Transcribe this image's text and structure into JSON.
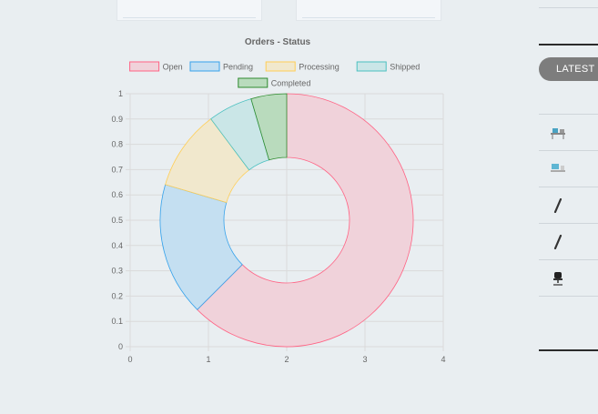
{
  "chart_data": {
    "type": "doughnut",
    "title": "Orders - Status",
    "legend_position": "top",
    "series": [
      {
        "name": "Open",
        "value": 0.6471,
        "color": "#ff6384",
        "fill": "#f0d2da"
      },
      {
        "name": "Pending",
        "value": 0.1765,
        "color": "#36a2eb",
        "fill": "#c4dff1"
      },
      {
        "name": "Processing",
        "value": 0.1059,
        "color": "#ffce56",
        "fill": "#f1e8cd"
      },
      {
        "name": "Shipped",
        "value": 0.0588,
        "color": "#4bc0c0",
        "fill": "#cae6e7"
      },
      {
        "name": "Completed",
        "value": 0.0471,
        "color": "#2e8b2e",
        "fill": "#b9dbbd"
      }
    ],
    "x_axis": {
      "min": 0,
      "max": 4,
      "ticks": [
        "0",
        "1",
        "2",
        "3",
        "4"
      ]
    },
    "y_axis": {
      "min": 0,
      "max": 1,
      "ticks": [
        "0",
        "0.1",
        "0.2",
        "0.3",
        "0.4",
        "0.5",
        "0.6",
        "0.7",
        "0.8",
        "0.9",
        "1"
      ]
    },
    "grid": true
  },
  "right_panel": {
    "tab_label": "LATEST P",
    "items": [
      {
        "icon": "desk-set-icon"
      },
      {
        "icon": "workstation-icon"
      },
      {
        "icon": "pen-icon"
      },
      {
        "icon": "pen-icon"
      },
      {
        "icon": "office-chair-icon"
      }
    ]
  }
}
